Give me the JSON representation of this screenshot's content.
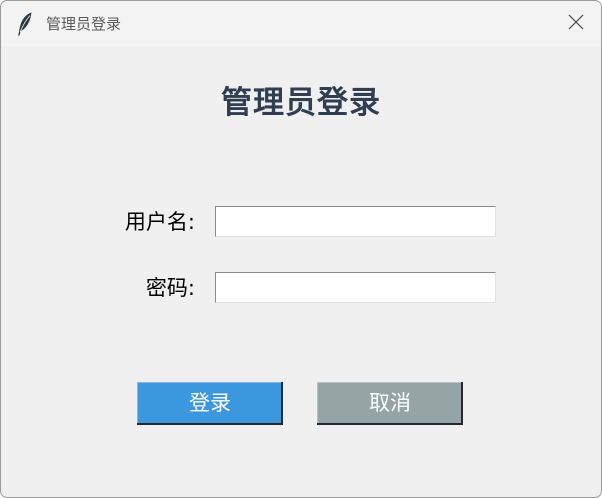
{
  "window": {
    "title": "管理员登录",
    "app_icon": "feather-icon",
    "close_icon": "close-icon"
  },
  "form": {
    "heading": "管理员登录",
    "username_label": "用户名:",
    "username_value": "",
    "password_label": "密码:",
    "password_value": ""
  },
  "buttons": {
    "login_label": "登录",
    "cancel_label": "取消"
  },
  "colors": {
    "heading": "#2f3e50",
    "login_button": "#3b97de",
    "cancel_button": "#95a5a6",
    "background": "#f0f0f0"
  }
}
